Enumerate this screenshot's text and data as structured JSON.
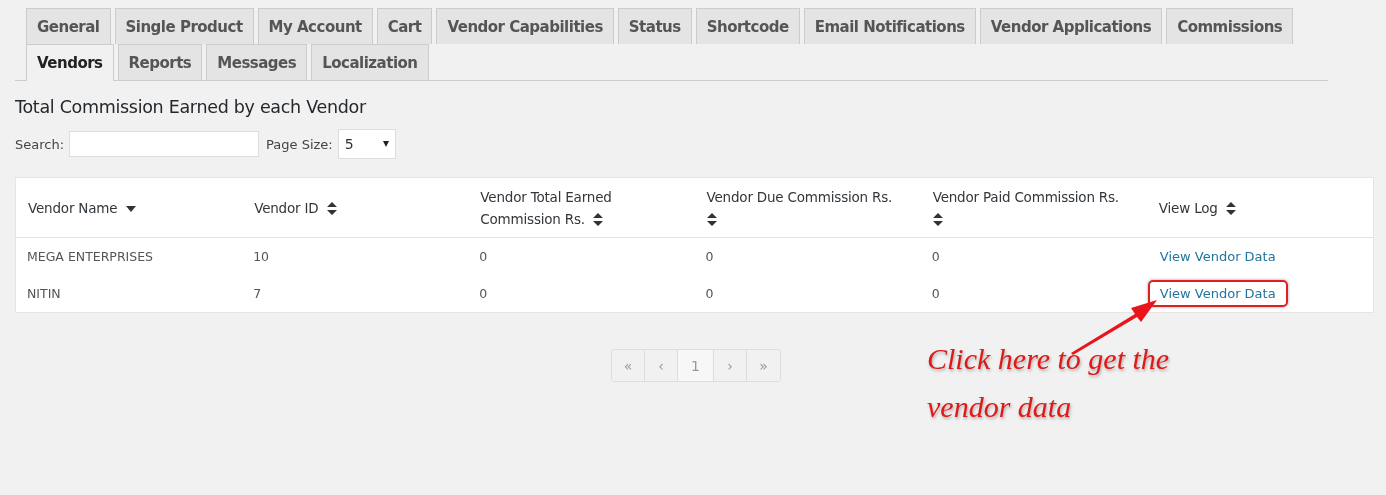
{
  "tabs": [
    {
      "label": "General",
      "selected": false
    },
    {
      "label": "Single Product",
      "selected": false
    },
    {
      "label": "My Account",
      "selected": false
    },
    {
      "label": "Cart",
      "selected": false
    },
    {
      "label": "Vendor Capabilities",
      "selected": false
    },
    {
      "label": "Status",
      "selected": false
    },
    {
      "label": "Shortcode",
      "selected": false
    },
    {
      "label": "Email Notifications",
      "selected": false
    },
    {
      "label": "Vendor Applications",
      "selected": false
    },
    {
      "label": "Commissions",
      "selected": false
    },
    {
      "label": "Vendors",
      "selected": true
    },
    {
      "label": "Reports",
      "selected": false
    },
    {
      "label": "Messages",
      "selected": false
    },
    {
      "label": "Localization",
      "selected": false
    }
  ],
  "heading": "Total Commission Earned by each Vendor",
  "search": {
    "label": "Search:"
  },
  "page_size": {
    "label": "Page Size:",
    "value": "5"
  },
  "table": {
    "columns": [
      {
        "label": "Vendor Name",
        "sorted": true
      },
      {
        "label": "Vendor ID",
        "sorted": false
      },
      {
        "label": "Vendor Total Earned Commission Rs.",
        "sorted": false
      },
      {
        "label": "Vendor Due Commission Rs.",
        "sorted": false
      },
      {
        "label": "Vendor Paid Commission Rs.",
        "sorted": false
      },
      {
        "label": "View Log",
        "sorted": false
      }
    ],
    "rows": [
      {
        "cells": [
          "MEGA ENTERPRISES",
          "10",
          "0",
          "0",
          "0"
        ],
        "link": "View Vendor Data",
        "highlighted": false
      },
      {
        "cells": [
          "NITIN",
          "7",
          "0",
          "0",
          "0"
        ],
        "link": "View Vendor Data",
        "highlighted": true
      }
    ]
  },
  "pagination": [
    {
      "label": "«",
      "selected": false
    },
    {
      "label": "‹",
      "selected": false
    },
    {
      "label": "1",
      "selected": true
    },
    {
      "label": "›",
      "selected": false
    },
    {
      "label": "»",
      "selected": false
    }
  ],
  "annotation": "Click here to get the vendor data"
}
